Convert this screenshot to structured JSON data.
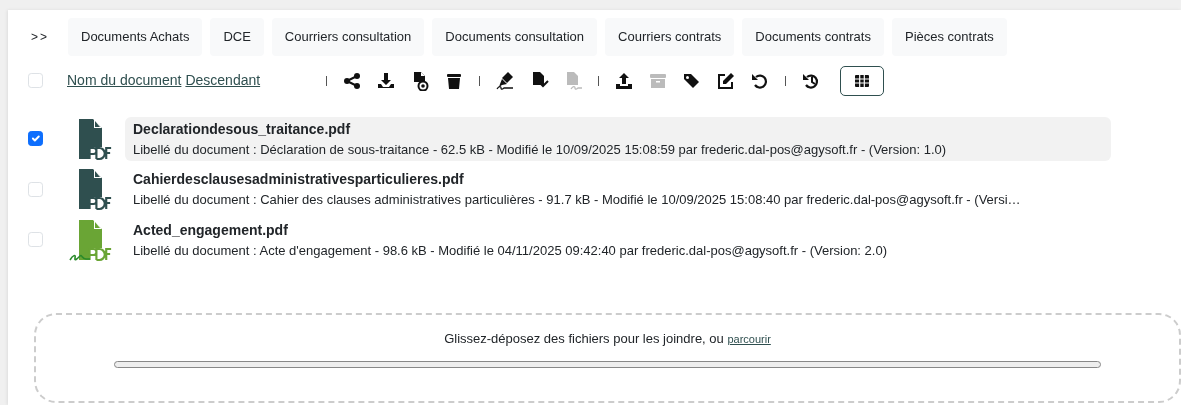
{
  "nav_toggle": ">>",
  "tabs": [
    {
      "label": "Documents Achats"
    },
    {
      "label": "DCE"
    },
    {
      "label": "Courriers consultation"
    },
    {
      "label": "Documents consultation"
    },
    {
      "label": "Courriers contrats"
    },
    {
      "label": "Documents contrats"
    },
    {
      "label": "Pièces contrats"
    }
  ],
  "select_all": {
    "checked": false
  },
  "sort": {
    "field": "Nom du document",
    "order": "Descendant"
  },
  "toolbar": [
    {
      "kind": "separator"
    },
    {
      "kind": "share",
      "disabled": false
    },
    {
      "kind": "download",
      "disabled": false
    },
    {
      "kind": "preview",
      "disabled": false
    },
    {
      "kind": "trash",
      "disabled": false
    },
    {
      "kind": "separator"
    },
    {
      "kind": "sign",
      "disabled": false
    },
    {
      "kind": "validate",
      "disabled": false
    },
    {
      "kind": "signdoc",
      "disabled": true
    },
    {
      "kind": "separator"
    },
    {
      "kind": "upload",
      "disabled": false
    },
    {
      "kind": "archive",
      "disabled": true
    },
    {
      "kind": "tags",
      "disabled": false
    },
    {
      "kind": "edit",
      "disabled": false
    },
    {
      "kind": "undo",
      "disabled": false
    },
    {
      "kind": "separator"
    },
    {
      "kind": "history",
      "disabled": false
    },
    {
      "kind": "grid",
      "disabled": false,
      "selected": true
    }
  ],
  "files": [
    {
      "checked": true,
      "selected": true,
      "kind": "pdf",
      "name": "Declarationdesous_traitance.pdf",
      "description": "Libellé du document : Déclaration de sous-traitance - 62.5 kB - Modifié le 10/09/2025 15:08:59 par frederic.dal-pos@agysoft.fr - (Version: 1.0)"
    },
    {
      "checked": false,
      "selected": false,
      "kind": "pdf",
      "name": "Cahierdesclausesadministrativesparticulieres.pdf",
      "description": "Libellé du document : Cahier des clauses administratives particulières - 91.7 kB - Modifié le 10/09/2025 15:08:40 par frederic.dal-pos@agysoft.fr - (Versi…"
    },
    {
      "checked": false,
      "selected": false,
      "kind": "signed",
      "name": "Acted_engagement.pdf",
      "description": "Libellé du document : Acte d'engagement - 98.6 kB - Modifié le 04/11/2025 09:42:40 par frederic.dal-pos@agysoft.fr - (Version: 2.0)"
    }
  ],
  "dropzone": {
    "text": "Glissez-déposez des fichiers pour les joindre, ou",
    "link": "parcourir",
    "level": 0
  }
}
